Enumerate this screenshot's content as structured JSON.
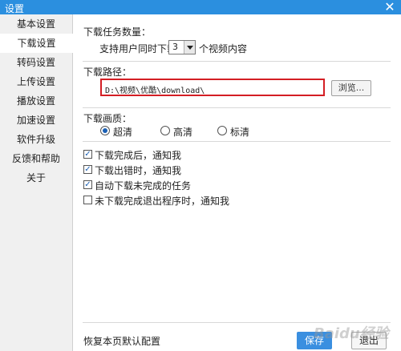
{
  "window": {
    "title": "设置"
  },
  "sidebar": {
    "items": [
      {
        "label": "基本设置"
      },
      {
        "label": "下载设置",
        "active": true
      },
      {
        "label": "转码设置"
      },
      {
        "label": "上传设置"
      },
      {
        "label": "播放设置"
      },
      {
        "label": "加速设置"
      },
      {
        "label": "软件升级"
      },
      {
        "label": "反馈和帮助"
      },
      {
        "label": "关于"
      }
    ]
  },
  "download": {
    "task_count_heading": "下载任务数量：",
    "task_count_prefix": "支持用户同时下载",
    "task_count_value": "3",
    "task_count_suffix": "个视频内容",
    "path_heading": "下载路径：",
    "path_value": "D:\\视频\\优酷\\download\\",
    "browse_label": "浏览...",
    "quality_heading": "下载画质：",
    "quality_options": [
      {
        "label": "超清",
        "selected": true
      },
      {
        "label": "高清",
        "selected": false
      },
      {
        "label": "标清",
        "selected": false
      }
    ],
    "checkboxes": [
      {
        "label": "下载完成后，通知我",
        "checked": true
      },
      {
        "label": "下载出错时，通知我",
        "checked": true
      },
      {
        "label": "自动下载未完成的任务",
        "checked": true
      },
      {
        "label": "未下载完成退出程序时，通知我",
        "checked": false
      }
    ]
  },
  "footer": {
    "restore_label": "恢复本页默认配置",
    "save_label": "保存",
    "exit_label": "退出"
  },
  "watermark": "Baidu经验",
  "colors": {
    "titlebar": "#2b8fdf",
    "highlight": "#d41e24",
    "primary_button": "#3a8fe0"
  }
}
